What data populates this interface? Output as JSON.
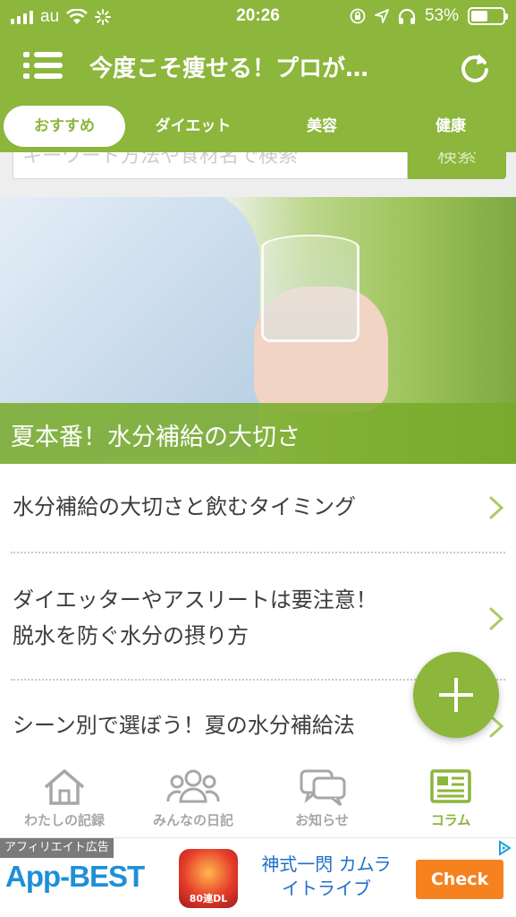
{
  "status_bar": {
    "carrier": "au",
    "time": "20:26",
    "battery_percent": "53%",
    "battery_level": 0.53
  },
  "header": {
    "title": "今度こそ痩せる！プロが…"
  },
  "tabs": [
    {
      "label": "おすすめ",
      "active": true
    },
    {
      "label": "ダイエット",
      "active": false
    },
    {
      "label": "美容",
      "active": false
    },
    {
      "label": "健康",
      "active": false
    }
  ],
  "search": {
    "placeholder_fragment": "キーワード方法や食材名で検索",
    "button_label": "検索"
  },
  "hero": {
    "caption": "夏本番！水分補給の大切さ"
  },
  "articles": [
    {
      "lines": [
        "水分補給の大切さと飲むタイミング"
      ]
    },
    {
      "lines": [
        "ダイエッターやアスリートは要注意！",
        "脱水を防ぐ水分の摂り方"
      ]
    },
    {
      "lines": [
        "シーン別で選ぼう！夏の水分補給法"
      ]
    }
  ],
  "bottom_nav": [
    {
      "label": "わたしの記録",
      "icon": "home-icon",
      "active": false
    },
    {
      "label": "みんなの日記",
      "icon": "people-icon",
      "active": false
    },
    {
      "label": "お知らせ",
      "icon": "chat-icon",
      "active": false
    },
    {
      "label": "コラム",
      "icon": "newspaper-icon",
      "active": true
    }
  ],
  "ad": {
    "label": "アフィリエイト広告",
    "logo": "App-BEST",
    "thumb_text": "80連DL",
    "title": "神式一閃 カムラ\nイトライブ",
    "cta": "Check"
  },
  "colors": {
    "brand_green": "#8cb63c",
    "ad_orange": "#f5821f",
    "ad_blue": "#1f6fc9"
  }
}
